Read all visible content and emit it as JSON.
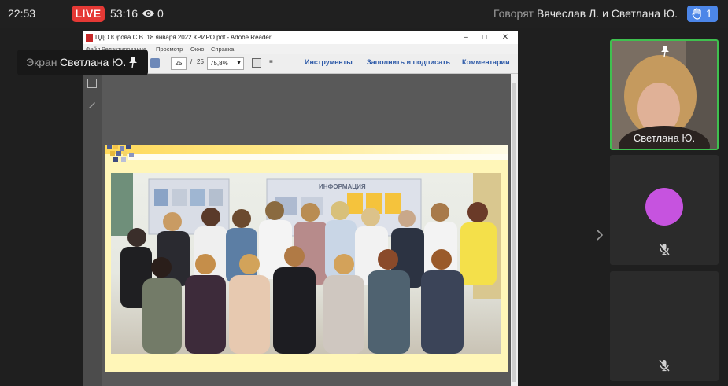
{
  "topbar": {
    "clock": "22:53",
    "live_label": "LIVE",
    "duration": "53:16",
    "viewer_count": "0",
    "speaking_label": "Говорят",
    "speaking_names": "Вячеслав Л. и Светлана Ю.",
    "raised_hands": "1"
  },
  "screen_share": {
    "label": "Экран",
    "presenter": "Светлана Ю."
  },
  "reader": {
    "title": "ЦДО Юрова С.В. 18 января 2022 КРИРО.pdf - Adobe Reader",
    "menu": [
      "Файл",
      "Редактирование",
      "Просмотр",
      "Окно",
      "Справка"
    ],
    "page_current": "25",
    "page_total": "25",
    "page_sep": "/",
    "zoom": "75,8%",
    "tools": [
      "Инструменты",
      "Заполнить и подписать",
      "Комментарии"
    ],
    "document": {
      "board_heading": "ИНФОРМАЦИЯ"
    }
  },
  "participants": [
    {
      "name": "Светлана Ю.",
      "pinned": true,
      "video": true,
      "speaking": true
    },
    {
      "name": "",
      "avatar_color": "#c653df",
      "muted": true
    },
    {
      "name": "",
      "muted": true
    }
  ],
  "colors": {
    "live": "#e53935",
    "hand_badge": "#4c86e8",
    "speaking_border": "#3fc04f",
    "page_background": "#fff6b8"
  }
}
